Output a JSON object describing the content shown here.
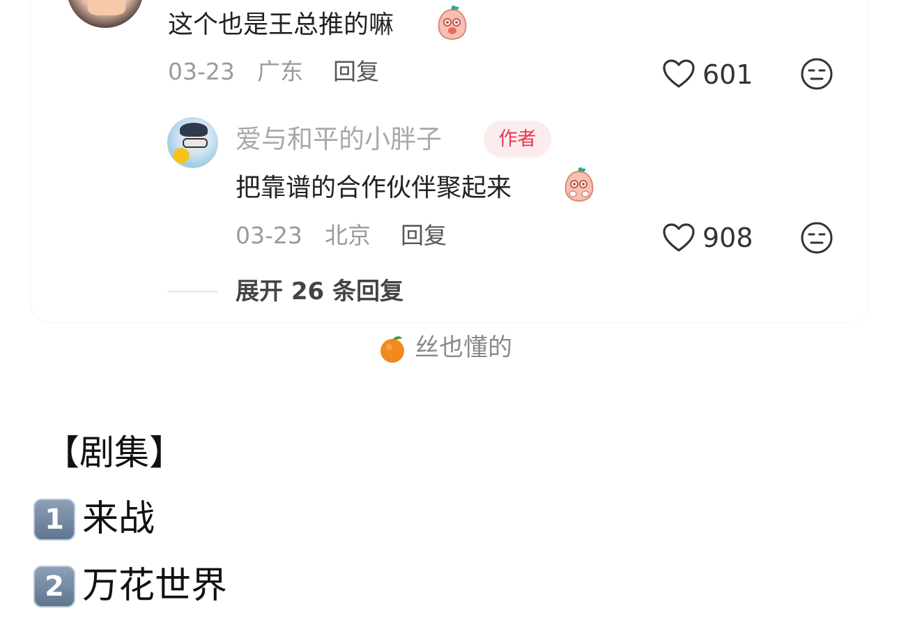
{
  "comment": {
    "text": "这个也是王总推的嘛",
    "date": "03-23",
    "location": "广东",
    "reply_label": "回复",
    "likes": "601"
  },
  "reply": {
    "username": "爱与和平的小胖子",
    "badge": "作者",
    "text": "把靠谱的合作伙伴聚起来",
    "date": "03-23",
    "location": "北京",
    "reply_label": "回复",
    "likes": "908"
  },
  "expand": {
    "label": "展开 26 条回复"
  },
  "related": {
    "text": "丝也懂的"
  },
  "body": {
    "section_title": "【剧集】",
    "items": [
      {
        "num": "1",
        "label": "来战"
      },
      {
        "num": "2",
        "label": "万花世界"
      }
    ]
  },
  "colors": {
    "badge_text": "#e5384f",
    "badge_bg": "#fdecee",
    "muted": "#9a9a9a"
  },
  "icons": [
    "heart-icon",
    "expressionless-face-icon",
    "peach-sticker-icon",
    "tangerine-icon"
  ]
}
